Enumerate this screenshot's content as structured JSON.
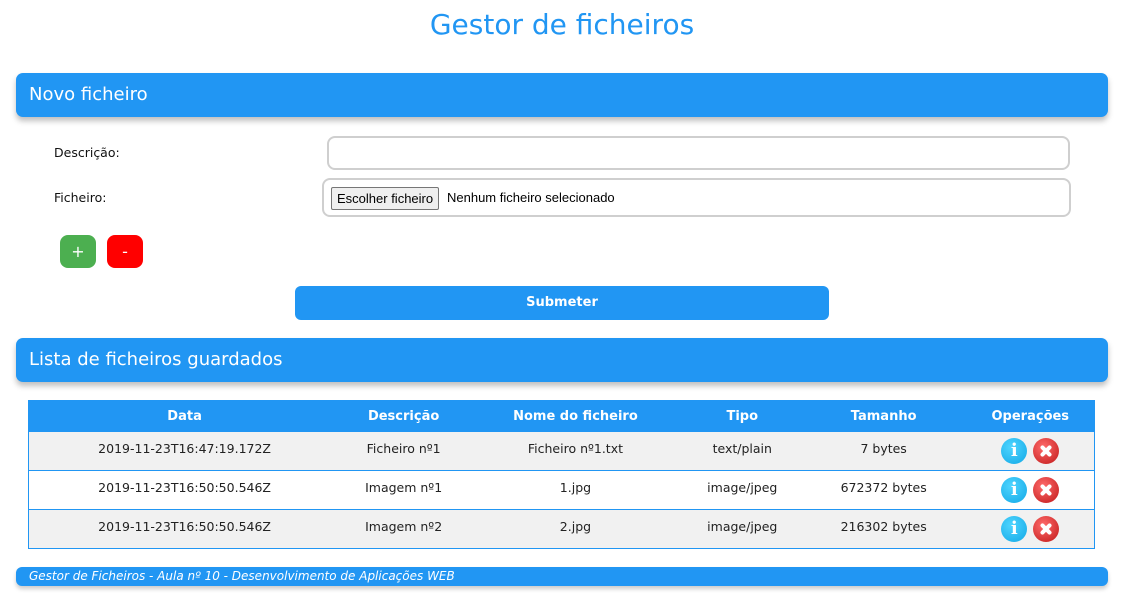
{
  "page": {
    "title": "Gestor de ficheiros"
  },
  "new_file": {
    "header": "Novo ficheiro",
    "description_label": "Descrição:",
    "description_value": "",
    "file_label": "Ficheiro:",
    "file_button": "Escolher ficheiro",
    "file_status": "Nenhum ficheiro selecionado",
    "add_label": "+",
    "remove_label": "-",
    "submit_label": "Submeter"
  },
  "file_list": {
    "header": "Lista de ficheiros guardados",
    "columns": [
      "Data",
      "Descrição",
      "Nome do ficheiro",
      "Tipo",
      "Tamanho",
      "Operações"
    ],
    "rows": [
      {
        "date": "2019-11-23T16:47:19.172Z",
        "description": "Ficheiro nº1",
        "filename": "Ficheiro nº1.txt",
        "type": "text/plain",
        "size": "7 bytes"
      },
      {
        "date": "2019-11-23T16:50:50.546Z",
        "description": "Imagem nº1",
        "filename": "1.jpg",
        "type": "image/jpeg",
        "size": "672372 bytes"
      },
      {
        "date": "2019-11-23T16:50:50.546Z",
        "description": "Imagem nº2",
        "filename": "2.jpg",
        "type": "image/jpeg",
        "size": "216302 bytes"
      }
    ],
    "info_glyph": "i"
  },
  "footer": {
    "text": "Gestor de Ficheiros - Aula nº 10 - Desenvolvimento de Aplicações WEB"
  },
  "icons": {
    "info": "info-icon",
    "delete": "delete-icon"
  },
  "colors": {
    "accent": "#2196f3",
    "add": "#4caf50",
    "remove": "#ff0000"
  }
}
